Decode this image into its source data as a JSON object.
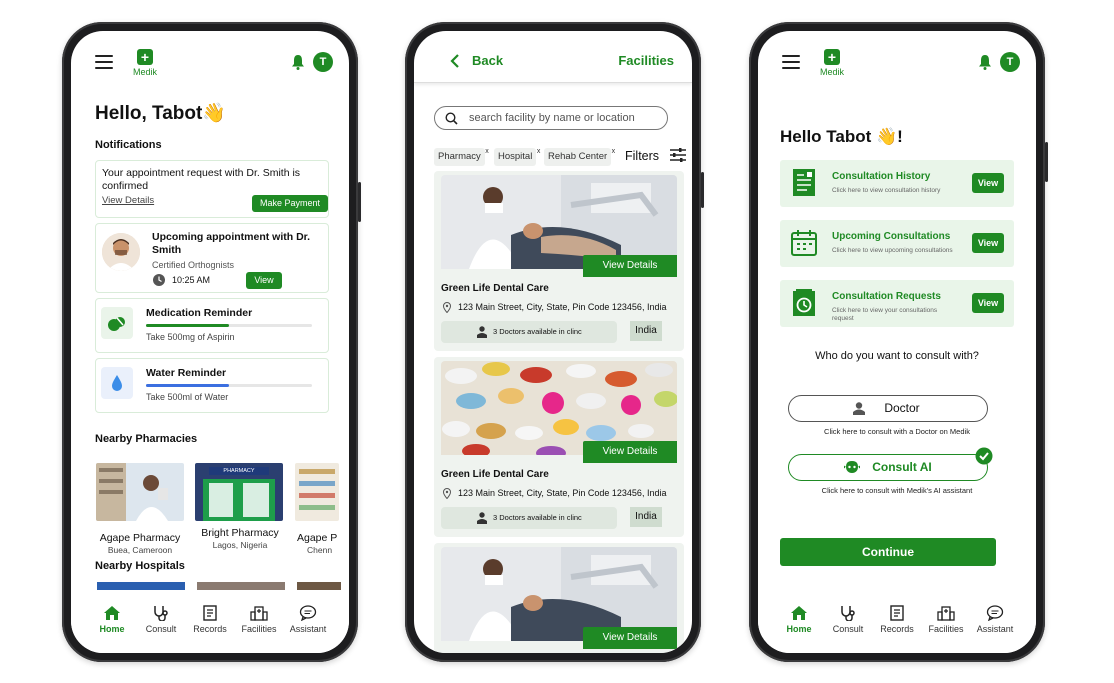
{
  "brand": {
    "name": "Medik",
    "green": "#1f8a24",
    "avatar_letter": "T"
  },
  "home": {
    "greeting": "Hello, Tabot👋",
    "notifications_title": "Notifications",
    "notice": {
      "text": "Your appointment request with Dr. Smith is confirmed",
      "link": "View Details",
      "button": "Make Payment"
    },
    "appointment": {
      "title": "Upcoming appointment with Dr. Smith",
      "role": "Certified Orthognists",
      "time": "10:25 AM",
      "button": "View"
    },
    "medication": {
      "title": "Medication Reminder",
      "detail": "Take 500mg of Aspirin",
      "progress": 0.5,
      "color": "#1f8a24"
    },
    "water": {
      "title": "Water Reminder",
      "detail": "Take 500ml of Water",
      "progress": 0.5,
      "color": "#3b6fe0"
    },
    "pharmacies_title": "Nearby Pharmacies",
    "pharmacies": [
      {
        "name": "Agape Pharmacy",
        "location": "Buea, Cameroon"
      },
      {
        "name": "Bright Pharmacy",
        "location": "Lagos, Nigeria",
        "sign": "PHARMACY"
      },
      {
        "name": "Agape P",
        "location": "Chenn"
      }
    ],
    "hospitals_title": "Nearby Hospitals"
  },
  "nav": {
    "home": "Home",
    "consult": "Consult",
    "records": "Records",
    "facilities": "Facilities",
    "assistant": "Assistant"
  },
  "facilities": {
    "back": "Back",
    "title": "Facilities",
    "search_placeholder": "search facility by name or location",
    "chips": [
      "Pharmacy",
      "Hospital",
      "Rehab Center"
    ],
    "chip_close": "x",
    "filters": "Filters",
    "cards": [
      {
        "name": "Green Life Dental Care",
        "address": "123 Main Street, City, State, Pin Code 123456, India",
        "doctors": "3 Doctors available in clinc",
        "country": "India",
        "button": "View Details"
      },
      {
        "name": "Green Life Dental Care",
        "address": "123 Main Street, City, State, Pin Code 123456, India",
        "doctors": "3 Doctors available in clinc",
        "country": "India",
        "button": "View Details"
      },
      {
        "button": "View Details"
      }
    ]
  },
  "consult": {
    "greeting": "Hello Tabot 👋!",
    "items": [
      {
        "title": "Consultation History",
        "subtitle": "Click here to view consultation history",
        "button": "View"
      },
      {
        "title": "Upcoming Consultations",
        "subtitle": "Click here to view upcoming consultations",
        "button": "View"
      },
      {
        "title": "Consultation Requests",
        "subtitle": "Click here to view your consultations request",
        "button": "View"
      }
    ],
    "question": "Who do you want to consult with?",
    "doctor": {
      "label": "Doctor",
      "hint": "Click here to consult with a Doctor on Medik"
    },
    "ai": {
      "label": "Consult AI",
      "hint": "Click here to consult with Medik's AI assistant"
    },
    "continue": "Continue"
  }
}
